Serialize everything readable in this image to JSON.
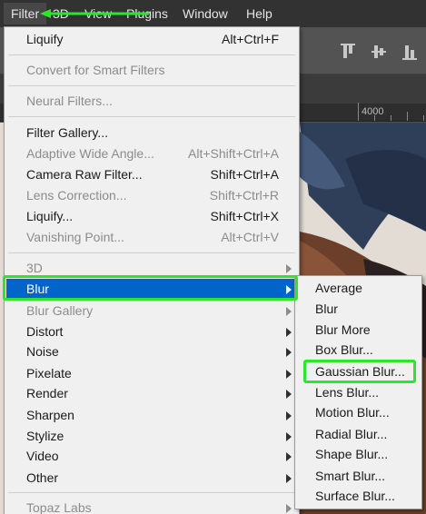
{
  "colors": {
    "highlight": "#0064c8",
    "annotation": "#2ee52e",
    "menu_bg": "#f0f0f0",
    "menubar_bg": "#323232"
  },
  "menubar": {
    "items": [
      "Filter",
      "3D",
      "View",
      "Plugins",
      "Window",
      "Help"
    ]
  },
  "ruler": {
    "label": "4000"
  },
  "filter_menu": {
    "items": [
      {
        "label": "Liquify",
        "shortcut": "Alt+Ctrl+F",
        "enabled": true
      },
      {
        "label": "Convert for Smart Filters",
        "shortcut": "",
        "enabled": false
      },
      {
        "label": "Neural Filters...",
        "shortcut": "",
        "enabled": false
      },
      {
        "label": "Filter Gallery...",
        "shortcut": "",
        "enabled": true
      },
      {
        "label": "Adaptive Wide Angle...",
        "shortcut": "Alt+Shift+Ctrl+A",
        "enabled": false
      },
      {
        "label": "Camera Raw Filter...",
        "shortcut": "Shift+Ctrl+A",
        "enabled": true
      },
      {
        "label": "Lens Correction...",
        "shortcut": "Shift+Ctrl+R",
        "enabled": false
      },
      {
        "label": "Liquify...",
        "shortcut": "Shift+Ctrl+X",
        "enabled": true
      },
      {
        "label": "Vanishing Point...",
        "shortcut": "Alt+Ctrl+V",
        "enabled": false
      },
      {
        "label": "3D",
        "shortcut": "",
        "enabled": false
      },
      {
        "label": "Blur",
        "shortcut": "",
        "enabled": true
      },
      {
        "label": "Blur Gallery",
        "shortcut": "",
        "enabled": false
      },
      {
        "label": "Distort",
        "shortcut": "",
        "enabled": true
      },
      {
        "label": "Noise",
        "shortcut": "",
        "enabled": true
      },
      {
        "label": "Pixelate",
        "shortcut": "",
        "enabled": true
      },
      {
        "label": "Render",
        "shortcut": "",
        "enabled": true
      },
      {
        "label": "Sharpen",
        "shortcut": "",
        "enabled": true
      },
      {
        "label": "Stylize",
        "shortcut": "",
        "enabled": true
      },
      {
        "label": "Video",
        "shortcut": "",
        "enabled": true
      },
      {
        "label": "Other",
        "shortcut": "",
        "enabled": true
      },
      {
        "label": "Topaz Labs",
        "shortcut": "",
        "enabled": false
      }
    ]
  },
  "blur_submenu": {
    "items": [
      "Average",
      "Blur",
      "Blur More",
      "Box Blur...",
      "Gaussian Blur...",
      "Lens Blur...",
      "Motion Blur...",
      "Radial Blur...",
      "Shape Blur...",
      "Smart Blur...",
      "Surface Blur..."
    ]
  }
}
